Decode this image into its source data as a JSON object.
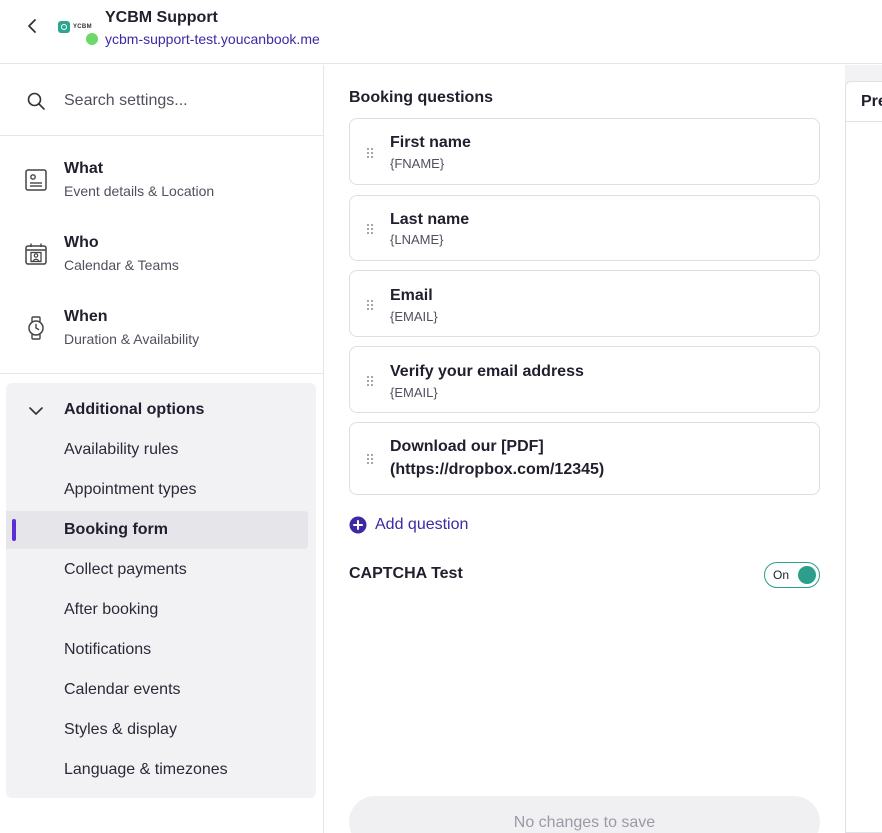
{
  "header": {
    "account_name": "YCBM Support",
    "account_url": "ycbm-support-test.youcanbook.me",
    "logo_text": "YCBM",
    "status_color": "#6cd86a",
    "back_icon": "chevron-left-icon"
  },
  "sidebar": {
    "search": {
      "placeholder": "Search settings...",
      "value": ""
    },
    "nav": [
      {
        "title": "What",
        "subtitle": "Event details & Location",
        "icon": "id-card-icon"
      },
      {
        "title": "Who",
        "subtitle": "Calendar & Teams",
        "icon": "calendar-person-icon"
      },
      {
        "title": "When",
        "subtitle": "Duration & Availability",
        "icon": "watch-icon"
      }
    ],
    "additional": {
      "label": "Additional options",
      "expanded": true,
      "items": [
        {
          "label": "Availability rules"
        },
        {
          "label": "Appointment types"
        },
        {
          "label": "Booking form",
          "active": true
        },
        {
          "label": "Collect payments"
        },
        {
          "label": "After booking"
        },
        {
          "label": "Notifications"
        },
        {
          "label": "Calendar events"
        },
        {
          "label": "Styles & display"
        },
        {
          "label": "Language & timezones"
        }
      ]
    }
  },
  "main": {
    "section_title": "Booking questions",
    "questions": [
      {
        "label": "First name",
        "token": "{FNAME}"
      },
      {
        "label": "Last name",
        "token": "{LNAME}"
      },
      {
        "label": "Email",
        "token": "{EMAIL}"
      },
      {
        "label": "Verify your email address",
        "token": "{EMAIL}"
      },
      {
        "label_line1": "Download our [PDF]",
        "label_line2": "(https://dropbox.com/12345)"
      }
    ],
    "add_question_label": "Add question",
    "captcha": {
      "label": "CAPTCHA Test",
      "toggle_text": "On",
      "enabled": true
    },
    "save_label": "No changes to save"
  },
  "preview": {
    "tab_label": "Preview"
  },
  "colors": {
    "accent": "#5b2fd6",
    "link": "#3b2aa3",
    "toggle": "#2b9e8c"
  }
}
